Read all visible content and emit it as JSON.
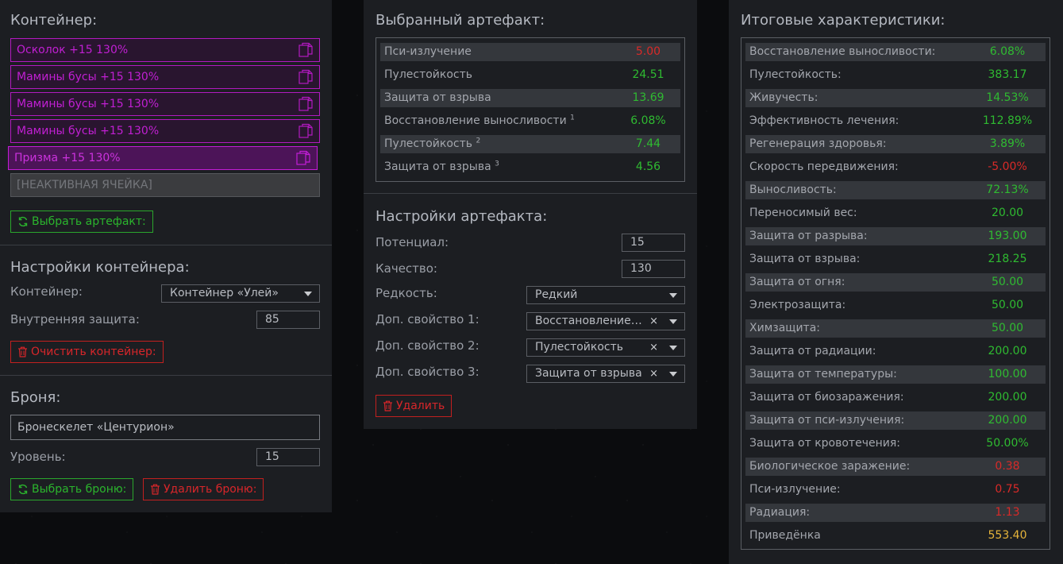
{
  "container": {
    "title": "Контейнер:",
    "slots": [
      {
        "label": "Осколок +15 130%"
      },
      {
        "label": "Мамины бусы +15 130%"
      },
      {
        "label": "Мамины бусы +15 130%"
      },
      {
        "label": "Мамины бусы +15 130%"
      },
      {
        "label": "Призма +15 130%"
      }
    ],
    "inactive_slot": "[НЕАКТИВНАЯ ЯЧЕЙКА]",
    "select_artifact_button": "Выбрать артефакт:"
  },
  "container_settings": {
    "title": "Настройки контейнера:",
    "container_label": "Контейнер:",
    "container_value": "Контейнер «Улей»",
    "inner_protection_label": "Внутренняя защита:",
    "inner_protection_value": "85",
    "clear_button": "Очистить контейнер:"
  },
  "armor": {
    "title": "Броня:",
    "armor_value": "Бронескелет «Центурион»",
    "level_label": "Уровень:",
    "level_value": "15",
    "select_button": "Выбрать броню:",
    "delete_button": "Удалить броню:"
  },
  "selected_artifact": {
    "title": "Выбранный артефакт:",
    "rows": [
      {
        "label": "Пси-излучение",
        "sup": "",
        "value": "5.00",
        "tone": "neg"
      },
      {
        "label": "Пулестойкость",
        "sup": "",
        "value": "24.51",
        "tone": "pos"
      },
      {
        "label": "Защита от взрыва",
        "sup": "",
        "value": "13.69",
        "tone": "pos"
      },
      {
        "label": "Восстановление выносливости",
        "sup": "1",
        "value": "6.08%",
        "tone": "pos"
      },
      {
        "label": "Пулестойкость",
        "sup": "2",
        "value": "7.44",
        "tone": "pos"
      },
      {
        "label": "Защита от взрыва",
        "sup": "3",
        "value": "4.56",
        "tone": "pos"
      }
    ]
  },
  "artifact_settings": {
    "title": "Настройки артефакта:",
    "potential_label": "Потенциал:",
    "potential_value": "15",
    "quality_label": "Качество:",
    "quality_value": "130",
    "rarity_label": "Редкость:",
    "rarity_value": "Редкий",
    "extra1_label": "Доп. свойство 1:",
    "extra1_value": "Восстановление выносливости",
    "extra2_label": "Доп. свойство 2:",
    "extra2_value": "Пулестойкость",
    "extra3_label": "Доп. свойство 3:",
    "extra3_value": "Защита от взрыва",
    "clear_symbol": "×",
    "delete_button": "Удалить"
  },
  "totals": {
    "title": "Итоговые характеристики:",
    "rows": [
      {
        "label": "Восстановление выносливости:",
        "value": "6.08%",
        "tone": "pos"
      },
      {
        "label": "Пулестойкость:",
        "value": "383.17",
        "tone": "pos"
      },
      {
        "label": "Живучесть:",
        "value": "14.53%",
        "tone": "pos"
      },
      {
        "label": "Эффективность лечения:",
        "value": "112.89%",
        "tone": "pos"
      },
      {
        "label": "Регенерация здоровья:",
        "value": "3.89%",
        "tone": "pos"
      },
      {
        "label": "Скорость передвижения:",
        "value": "-5.00%",
        "tone": "neg"
      },
      {
        "label": "Выносливость:",
        "value": "72.13%",
        "tone": "pos"
      },
      {
        "label": "Переносимый вес:",
        "value": "20.00",
        "tone": "pos"
      },
      {
        "label": "Защита от разрыва:",
        "value": "193.00",
        "tone": "pos"
      },
      {
        "label": "Защита от взрыва:",
        "value": "218.25",
        "tone": "pos"
      },
      {
        "label": "Защита от огня:",
        "value": "50.00",
        "tone": "pos"
      },
      {
        "label": "Электрозащита:",
        "value": "50.00",
        "tone": "pos"
      },
      {
        "label": "Химзащита:",
        "value": "50.00",
        "tone": "pos"
      },
      {
        "label": "Защита от радиации:",
        "value": "200.00",
        "tone": "pos"
      },
      {
        "label": "Защита от температуры:",
        "value": "100.00",
        "tone": "pos"
      },
      {
        "label": "Защита от биозаражения:",
        "value": "200.00",
        "tone": "pos"
      },
      {
        "label": "Защита от пси-излучения:",
        "value": "200.00",
        "tone": "pos"
      },
      {
        "label": "Защита от кровотечения:",
        "value": "50.00%",
        "tone": "pos"
      },
      {
        "label": "Биологическое заражение:",
        "value": "0.38",
        "tone": "neg"
      },
      {
        "label": "Пси-излучение:",
        "value": "0.75",
        "tone": "neg"
      },
      {
        "label": "Радиация:",
        "value": "1.13",
        "tone": "neg"
      },
      {
        "label": "Приведёнка",
        "value": "553.40",
        "tone": "gold"
      }
    ]
  },
  "colors": {
    "slot_purple": "#c11fd3",
    "positive": "#2fbb31",
    "negative": "#d92a28",
    "gold": "#e6b43a"
  },
  "icons": {
    "slot": "copy-icon",
    "select": "refresh-icon",
    "delete": "trash-icon"
  }
}
